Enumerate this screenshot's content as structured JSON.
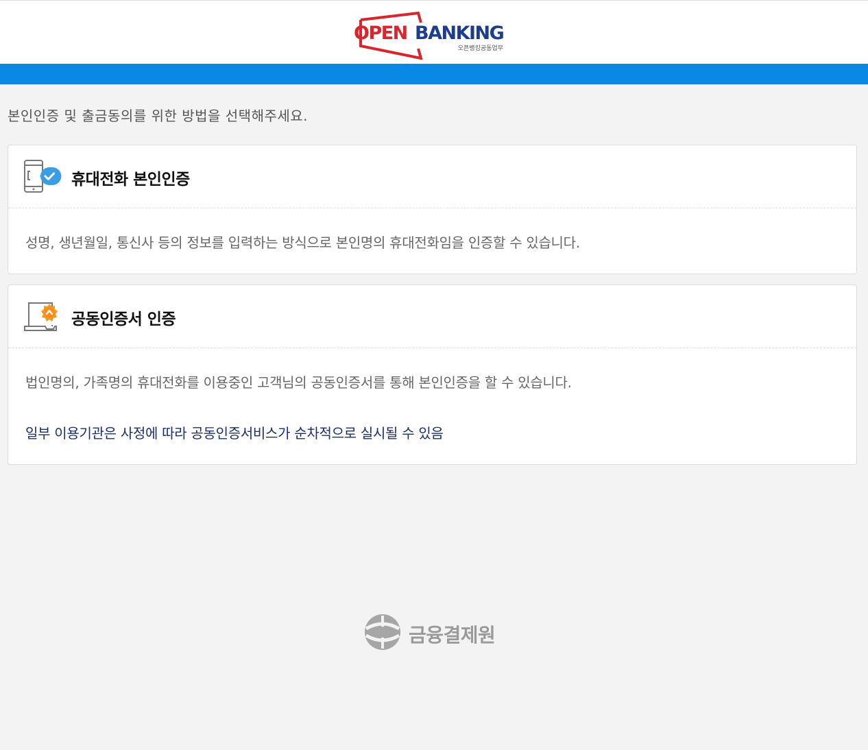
{
  "header": {
    "logo": {
      "open": "OPEN",
      "banking": "BANKING",
      "subtitle": "오픈뱅킹공동업무",
      "icon": "openbanking-logo-frame",
      "colors": {
        "open": "#d9262c",
        "banking": "#1d3d8f"
      }
    },
    "accent_bar_color": "#0a89e4"
  },
  "main": {
    "instruction": "본인인증 및 출금동의를 위한 방법을 선택해주세요.",
    "options": [
      {
        "icon": "phone-check-icon",
        "title": "휴대전화 본인인증",
        "description": "성명, 생년월일, 통신사 등의 정보를 입력하는 방식으로 본인명의 휴대전화임을 인증할 수 있습니다."
      },
      {
        "icon": "certificate-laptop-icon",
        "title": "공동인증서 인증",
        "description": "법인명의, 가족명의 휴대전화를 이용중인 고객님의 공동인증서를 통해 본인인증을 할 수 있습니다.",
        "note": "일부 이용기관은 사정에 따라 공동인증서비스가 순차적으로 실시될 수 있음"
      }
    ]
  },
  "footer": {
    "org_name": "금융결제원",
    "icon": "kftc-logo-icon"
  }
}
